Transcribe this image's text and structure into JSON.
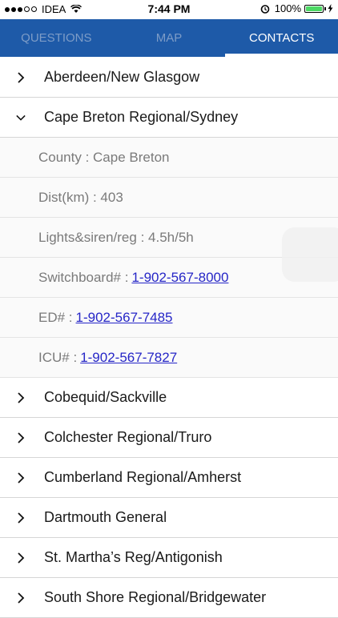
{
  "status": {
    "carrier": "IDEA",
    "time": "7:44 PM",
    "battery": "100%"
  },
  "tabs": [
    {
      "label": "QUESTIONS",
      "active": false
    },
    {
      "label": "MAP",
      "active": false
    },
    {
      "label": "CONTACTS",
      "active": true
    }
  ],
  "hospitals": {
    "aberdeen": "Aberdeen/New Glasgow",
    "cape_breton": "Cape Breton Regional/Sydney",
    "cobequid": "Cobequid/Sackville",
    "colchester": "Colchester Regional/Truro",
    "cumberland": "Cumberland Regional/Amherst",
    "dartmouth": "Dartmouth General",
    "st_martha": "St. Martha’s Reg/Antigonish",
    "south_shore": "South Shore Regional/Bridgewater"
  },
  "details": {
    "county": "County : Cape Breton",
    "dist": "Dist(km) : 403",
    "lights": "Lights&siren/reg : 4.5h/5h",
    "switchboard_label": "Switchboard# :",
    "switchboard_number": "1-902-567-8000",
    "ed_label": "ED# :",
    "ed_number": "1-902-567-7485",
    "icu_label": "ICU# :",
    "icu_number": "1-902-567-7827"
  },
  "colors": {
    "header": "#1e5aa8",
    "link": "#2626c7",
    "battery": "#4cd964"
  }
}
